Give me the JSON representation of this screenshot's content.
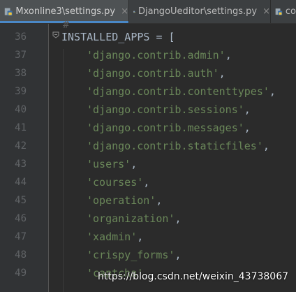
{
  "tabs": [
    {
      "label": "Mxonline3\\settings.py",
      "active": true
    },
    {
      "label": "DjangoUeditor\\settings.py",
      "active": false
    },
    {
      "label": "co",
      "active": false
    }
  ],
  "close_glyph": "×",
  "editor": {
    "lines": [
      {
        "num": "36",
        "text": "INSTALLED_APPS = [",
        "kind": "plain"
      },
      {
        "num": "37",
        "text": "'django.contrib.admin'",
        "kind": "str"
      },
      {
        "num": "38",
        "text": "'django.contrib.auth'",
        "kind": "str"
      },
      {
        "num": "39",
        "text": "'django.contrib.contenttypes'",
        "kind": "str"
      },
      {
        "num": "40",
        "text": "'django.contrib.sessions'",
        "kind": "str"
      },
      {
        "num": "41",
        "text": "'django.contrib.messages'",
        "kind": "str"
      },
      {
        "num": "42",
        "text": "'django.contrib.staticfiles'",
        "kind": "str"
      },
      {
        "num": "43",
        "text": "'users'",
        "kind": "str"
      },
      {
        "num": "44",
        "text": "'courses'",
        "kind": "str"
      },
      {
        "num": "45",
        "text": "'operation'",
        "kind": "str"
      },
      {
        "num": "46",
        "text": "'organization'",
        "kind": "str"
      },
      {
        "num": "47",
        "text": "'xadmin'",
        "kind": "str"
      },
      {
        "num": "48",
        "text": "'crispy_forms'",
        "kind": "str"
      },
      {
        "num": "49",
        "text": "'captcha'",
        "kind": "str"
      }
    ],
    "comma": ","
  },
  "colors": {
    "background": "#2b2b2b",
    "string": "#6a8759",
    "plain": "#a9b7c6",
    "line_number": "#606366"
  },
  "watermark": "https://blog.csdn.net/weixin_43738067"
}
